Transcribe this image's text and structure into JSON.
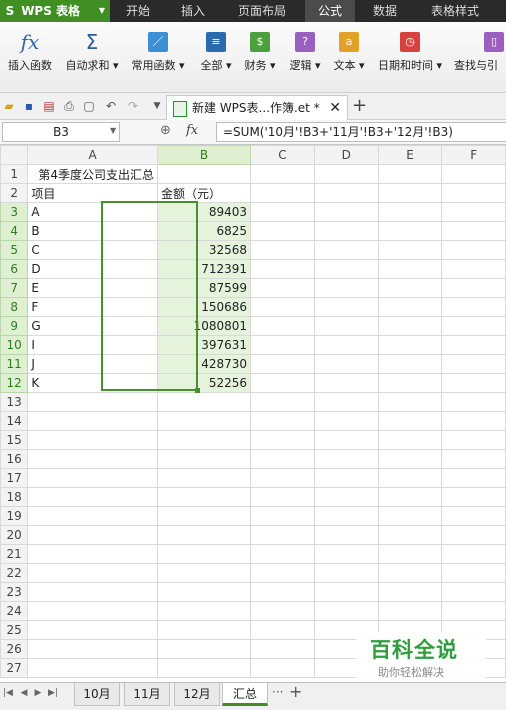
{
  "menu": {
    "app_name": "WPS 表格",
    "tabs": [
      "开始",
      "插入",
      "页面布局",
      "公式",
      "数据",
      "表格样式"
    ],
    "active_tab": "公式"
  },
  "ribbon": {
    "buttons": [
      "插入函数",
      "自动求和",
      "常用函数",
      "全部",
      "财务",
      "逻辑",
      "文本",
      "日期和时间",
      "查找与引"
    ]
  },
  "document": {
    "tab_title": "新建 WPS表...作簿.et *"
  },
  "formula_bar": {
    "name_box": "B3",
    "fx_label": "fx",
    "formula": "=SUM('10月'!B3+'11月'!B3+'12月'!B3)"
  },
  "grid": {
    "columns": [
      "A",
      "B",
      "C",
      "D",
      "E",
      "F"
    ],
    "selected_column": "B",
    "rows": [
      {
        "n": "1",
        "a": "第4季度公司支出汇总",
        "b": ""
      },
      {
        "n": "2",
        "a": "项目",
        "b": "金额（元）"
      },
      {
        "n": "3",
        "a": "A",
        "b": "89403"
      },
      {
        "n": "4",
        "a": "B",
        "b": "6825"
      },
      {
        "n": "5",
        "a": "C",
        "b": "32568"
      },
      {
        "n": "6",
        "a": "D",
        "b": "712391"
      },
      {
        "n": "7",
        "a": "E",
        "b": "87599"
      },
      {
        "n": "8",
        "a": "F",
        "b": "150686"
      },
      {
        "n": "9",
        "a": "G",
        "b": "1080801"
      },
      {
        "n": "10",
        "a": "I",
        "b": "397631"
      },
      {
        "n": "11",
        "a": "J",
        "b": "428730"
      },
      {
        "n": "12",
        "a": "K",
        "b": "52256"
      },
      {
        "n": "13",
        "a": "",
        "b": ""
      },
      {
        "n": "14",
        "a": "",
        "b": ""
      },
      {
        "n": "15",
        "a": "",
        "b": ""
      },
      {
        "n": "16",
        "a": "",
        "b": ""
      },
      {
        "n": "17",
        "a": "",
        "b": ""
      },
      {
        "n": "18",
        "a": "",
        "b": ""
      },
      {
        "n": "19",
        "a": "",
        "b": ""
      },
      {
        "n": "20",
        "a": "",
        "b": ""
      },
      {
        "n": "21",
        "a": "",
        "b": ""
      },
      {
        "n": "22",
        "a": "",
        "b": ""
      },
      {
        "n": "23",
        "a": "",
        "b": ""
      },
      {
        "n": "24",
        "a": "",
        "b": ""
      },
      {
        "n": "25",
        "a": "",
        "b": ""
      },
      {
        "n": "26",
        "a": "",
        "b": ""
      },
      {
        "n": "27",
        "a": "",
        "b": ""
      }
    ]
  },
  "sheet_tabs": {
    "tabs": [
      "10月",
      "11月",
      "12月",
      "汇总"
    ],
    "active": "汇总",
    "more": "···",
    "add": "+"
  },
  "watermark": {
    "title": "百科全说",
    "subtitle": "助你轻松解决"
  },
  "colors": {
    "accent": "#3f8f22",
    "menu_bg": "#2a2a2a",
    "selection_fill": "#e6f3dc"
  }
}
